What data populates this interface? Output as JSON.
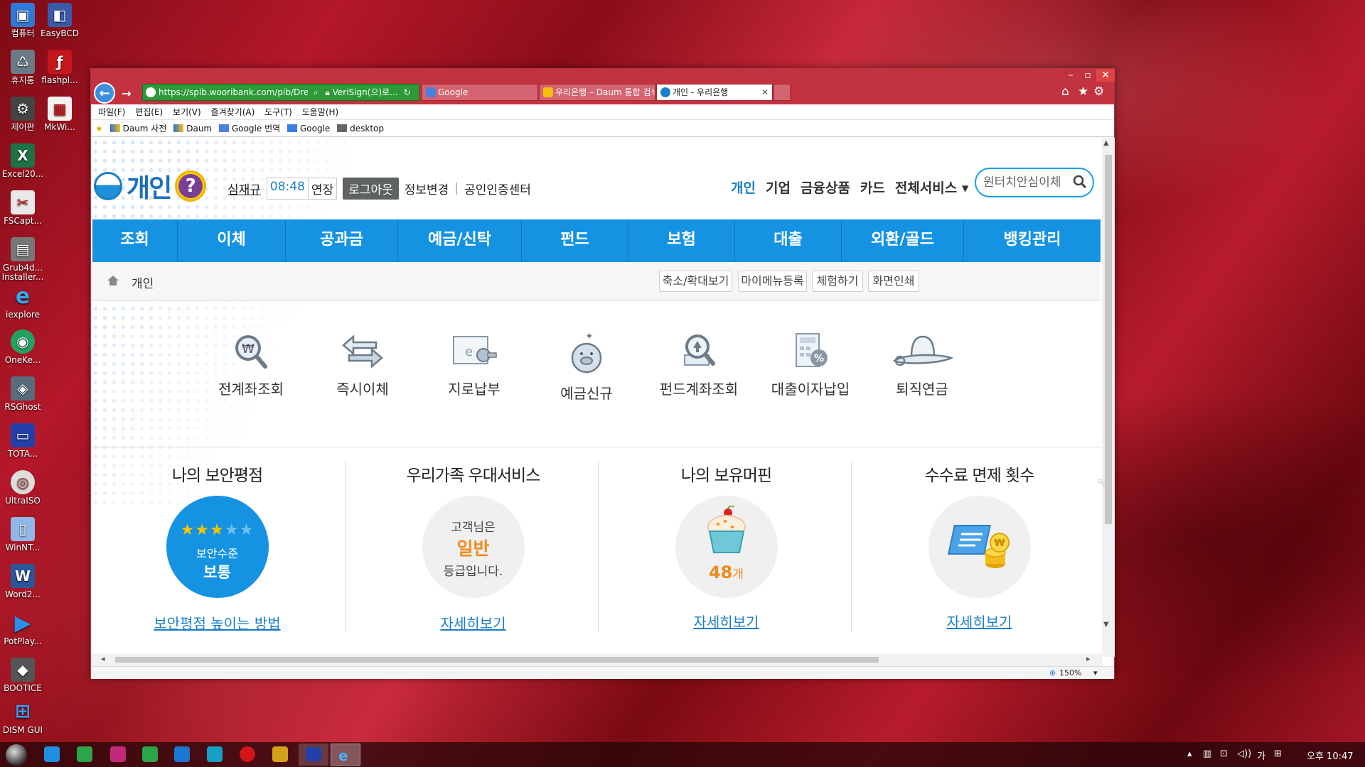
{
  "desktop_icons": [
    {
      "label": "컴퓨터",
      "icon": "computer-icon"
    },
    {
      "label": "EasyBCD",
      "icon": "easybcd-icon"
    },
    {
      "label": "휴지통",
      "icon": "recycle-bin-icon"
    },
    {
      "label": "flashpl...",
      "icon": "flash-player-icon"
    },
    {
      "label": "제어판",
      "icon": "control-panel-icon"
    },
    {
      "label": "MkWi...",
      "icon": "mkwim-icon"
    },
    {
      "label": "Excel20...",
      "icon": "excel-icon"
    },
    {
      "label": "FSCapt...",
      "icon": "fscapture-icon"
    },
    {
      "label": "Grub4d... Installer...",
      "icon": "grub4dos-icon"
    },
    {
      "label": "iexplore",
      "icon": "ie-icon"
    },
    {
      "label": "OneKe...",
      "icon": "onekey-icon"
    },
    {
      "label": "RSGhost",
      "icon": "rsghost-icon"
    },
    {
      "label": "TOTA...",
      "icon": "total-commander-icon"
    },
    {
      "label": "UltraISO",
      "icon": "ultraiso-icon"
    },
    {
      "label": "WinNT...",
      "icon": "winntsetup-icon"
    },
    {
      "label": "Word2...",
      "icon": "word-icon"
    },
    {
      "label": "PotPlay...",
      "icon": "potplayer-icon"
    },
    {
      "label": "BOOTICE",
      "icon": "bootice-icon"
    },
    {
      "label": "DISM GUI",
      "icon": "dism-icon"
    }
  ],
  "browser": {
    "address": "https://spib.wooribank.com/pib/Dre",
    "cert": "VeriSign(으)로...",
    "tabs": [
      {
        "label": "Google",
        "active": false
      },
      {
        "label": "우리은행 – Daum 통합 검색",
        "active": false
      },
      {
        "label": "개인 - 우리은행",
        "active": true
      }
    ],
    "menu": [
      "파일(F)",
      "편집(E)",
      "보기(V)",
      "즐겨찾기(A)",
      "도구(T)",
      "도움말(H)"
    ],
    "favorites": [
      "Daum 사전",
      "Daum",
      "Google 번역",
      "Google",
      "desktop"
    ],
    "zoom": "150%"
  },
  "site": {
    "logo_text": "개인",
    "help_label": "?",
    "user_name": "심재규",
    "session_timer": "08:48",
    "extend_label": "연장",
    "logout_label": "로그아웃",
    "info_change": "정보변경",
    "cert_center": "공인인증센터",
    "top_nav": [
      "개인",
      "기업",
      "금융상품",
      "카드",
      "전체서비스 ▾"
    ],
    "search_placeholder": "원터치안심이체",
    "gnb": [
      "조회",
      "이체",
      "공과금",
      "예금/신탁",
      "펀드",
      "보험",
      "대출",
      "외환/골드",
      "뱅킹관리"
    ],
    "breadcrumb": "개인",
    "utilities": [
      "축소/확대보기",
      "마이메뉴등록",
      "체험하기",
      "화면인쇄"
    ],
    "quick_menu": [
      "전계좌조회",
      "즉시이체",
      "지로납부",
      "예금신규",
      "펀드계좌조회",
      "대출이자납입",
      "퇴직연금"
    ],
    "cards": [
      {
        "title": "나의 보안평점",
        "line1": "보안수준",
        "line2": "보통",
        "link": "보안평점 높이는 방법",
        "stars": 2.5,
        "stars_total": 5
      },
      {
        "title": "우리가족 우대서비스",
        "line1": "고객님은",
        "line2": "일반",
        "line3": "등급입니다.",
        "link": "자세히보기"
      },
      {
        "title": "나의 보유머핀",
        "count": "48",
        "unit": "개",
        "link": "자세히보기"
      },
      {
        "title": "수수료 면제 횟수",
        "link": "자세히보기"
      }
    ]
  },
  "taskbar": {
    "ime": "가",
    "clock": "오후 10:47"
  },
  "colors": {
    "brand_blue": "#1593e2",
    "dark_blue": "#1c6fbc",
    "accent_orange": "#f08a1c",
    "titlebar": "#c2323f"
  }
}
